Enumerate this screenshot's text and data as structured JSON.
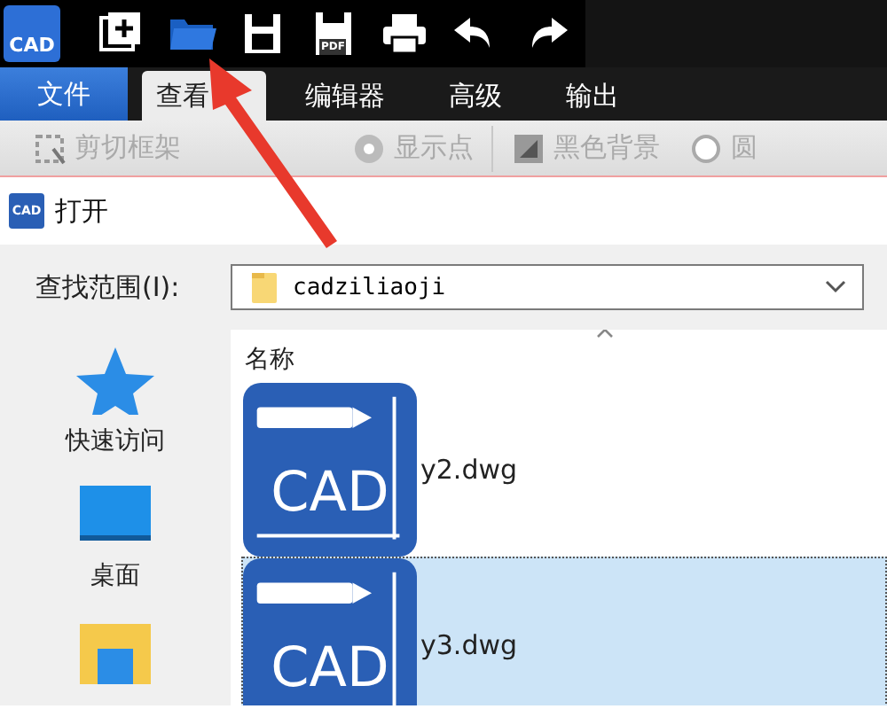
{
  "toolbar": {
    "buttons": [
      {
        "kind": "logo",
        "label": "CAD"
      },
      {
        "kind": "new"
      },
      {
        "kind": "open"
      },
      {
        "kind": "save"
      },
      {
        "kind": "save-pdf",
        "label": "PDF"
      },
      {
        "kind": "print"
      },
      {
        "kind": "undo"
      },
      {
        "kind": "redo"
      }
    ]
  },
  "tabs": [
    {
      "label": "文件",
      "kind": "file",
      "selected": false
    },
    {
      "label": "查看",
      "kind": "tab",
      "selected": true
    },
    {
      "label": "编辑器",
      "kind": "tab",
      "selected": false
    },
    {
      "label": "高级",
      "kind": "tab",
      "selected": false
    },
    {
      "label": "输出",
      "kind": "tab",
      "selected": false
    }
  ],
  "ribbon": [
    {
      "label": "剪切框架",
      "kind": "crop",
      "disabled": true
    },
    {
      "label": "显示点",
      "kind": "points",
      "disabled": true
    },
    {
      "label": "黑色背景",
      "kind": "background",
      "disabled": true
    },
    {
      "label": "圆",
      "kind": "circle",
      "disabled": true
    }
  ],
  "dialog": {
    "title": "打开",
    "icon_label": "CAD",
    "look_in": {
      "label": "查找范围(I):",
      "value": "cadziliaoji"
    },
    "places": [
      {
        "kind": "star",
        "label": "快速访问"
      },
      {
        "kind": "desktop",
        "label": "桌面"
      },
      {
        "kind": "folder"
      }
    ],
    "column": "名称",
    "files": [
      {
        "name": "y2.dwg",
        "icon_label": "CAD",
        "selected": false
      },
      {
        "name": "y3.dwg",
        "icon_label": "CAD",
        "selected": true
      }
    ]
  }
}
